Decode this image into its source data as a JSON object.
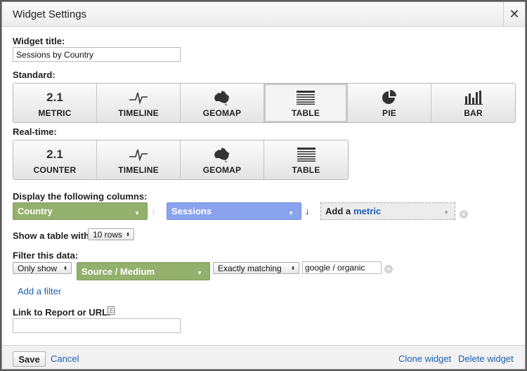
{
  "dialog": {
    "title": "Widget Settings",
    "close_glyph": "✕"
  },
  "widget_title": {
    "label": "Widget title:",
    "value": "Sessions by Country"
  },
  "standard": {
    "label": "Standard:",
    "buttons": [
      {
        "icon": "2.1",
        "label": "METRIC"
      },
      {
        "icon": "timeline-icon",
        "label": "TIMELINE"
      },
      {
        "icon": "geomap-icon",
        "label": "GEOMAP"
      },
      {
        "icon": "table-icon",
        "label": "TABLE",
        "selected": true
      },
      {
        "icon": "pie-icon",
        "label": "PIE"
      },
      {
        "icon": "bar-icon",
        "label": "BAR"
      }
    ]
  },
  "realtime": {
    "label": "Real-time:",
    "buttons": [
      {
        "icon": "2.1",
        "label": "COUNTER"
      },
      {
        "icon": "timeline-icon",
        "label": "TIMELINE"
      },
      {
        "icon": "geomap-icon",
        "label": "GEOMAP"
      },
      {
        "icon": "table-icon",
        "label": "TABLE"
      }
    ]
  },
  "columns": {
    "label": "Display the following columns:",
    "dimension": "Country",
    "metric": "Sessions",
    "add_metric_prefix": "Add a",
    "add_metric_word": "metric",
    "colors": {
      "dimension": "#93b16d",
      "metric": "#8aa3ef"
    }
  },
  "table_rows": {
    "label": "Show a table with",
    "value": "10 rows"
  },
  "filter": {
    "label": "Filter this data:",
    "mode": "Only show",
    "dimension": "Source / Medium",
    "match": "Exactly matching",
    "value": "google / organic",
    "add_filter": "Add a filter"
  },
  "link": {
    "label": "Link to Report or URL:",
    "value": ""
  },
  "footer": {
    "save": "Save",
    "cancel": "Cancel",
    "clone": "Clone widget",
    "delete": "Delete widget"
  }
}
